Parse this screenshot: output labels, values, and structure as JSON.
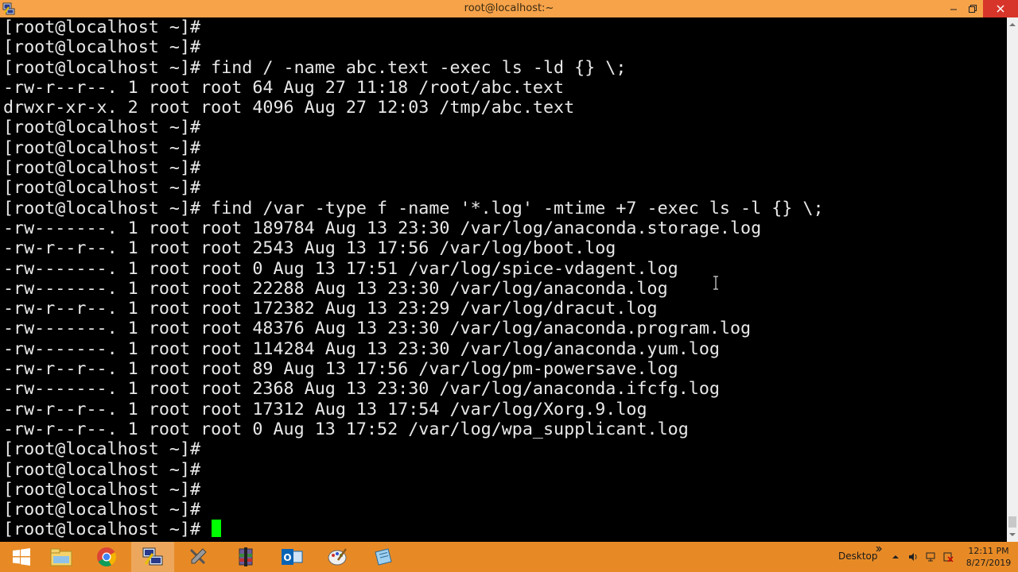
{
  "window": {
    "title": "root@localhost:~"
  },
  "terminal": {
    "lines": [
      "[root@localhost ~]#",
      "[root@localhost ~]#",
      "[root@localhost ~]# find / -name abc.text -exec ls -ld {} \\;",
      "-rw-r--r--. 1 root root 64 Aug 27 11:18 /root/abc.text",
      "drwxr-xr-x. 2 root root 4096 Aug 27 12:03 /tmp/abc.text",
      "[root@localhost ~]#",
      "[root@localhost ~]#",
      "[root@localhost ~]#",
      "[root@localhost ~]#",
      "[root@localhost ~]# find /var -type f -name '*.log' -mtime +7 -exec ls -l {} \\;",
      "-rw-------. 1 root root 189784 Aug 13 23:30 /var/log/anaconda.storage.log",
      "-rw-r--r--. 1 root root 2543 Aug 13 17:56 /var/log/boot.log",
      "-rw-------. 1 root root 0 Aug 13 17:51 /var/log/spice-vdagent.log",
      "-rw-------. 1 root root 22288 Aug 13 23:30 /var/log/anaconda.log",
      "-rw-r--r--. 1 root root 172382 Aug 13 23:29 /var/log/dracut.log",
      "-rw-------. 1 root root 48376 Aug 13 23:30 /var/log/anaconda.program.log",
      "-rw-------. 1 root root 114284 Aug 13 23:30 /var/log/anaconda.yum.log",
      "-rw-r--r--. 1 root root 89 Aug 13 17:56 /var/log/pm-powersave.log",
      "-rw-------. 1 root root 2368 Aug 13 23:30 /var/log/anaconda.ifcfg.log",
      "-rw-r--r--. 1 root root 17312 Aug 13 17:54 /var/log/Xorg.9.log",
      "-rw-r--r--. 1 root root 0 Aug 13 17:52 /var/log/wpa_supplicant.log",
      "[root@localhost ~]#",
      "[root@localhost ~]#",
      "[root@localhost ~]#",
      "[root@localhost ~]#"
    ],
    "prompt": "[root@localhost ~]# ",
    "text_color": "#e8e8e8",
    "background": "#000000",
    "cursor_color": "#00ff00"
  },
  "taskbar": {
    "apps": [
      "start-icon",
      "file-explorer-icon",
      "chrome-icon",
      "putty-icon",
      "tools-icon",
      "archive-icon",
      "outlook-icon",
      "paint-icon",
      "notepad-icon"
    ],
    "desktop_label": "Desktop",
    "clock_time": "12:11 PM",
    "clock_date": "8/27/2019",
    "color": "#e78a26"
  },
  "colors": {
    "titlebar": "#f6a34a",
    "close_button": "#d8352a"
  }
}
